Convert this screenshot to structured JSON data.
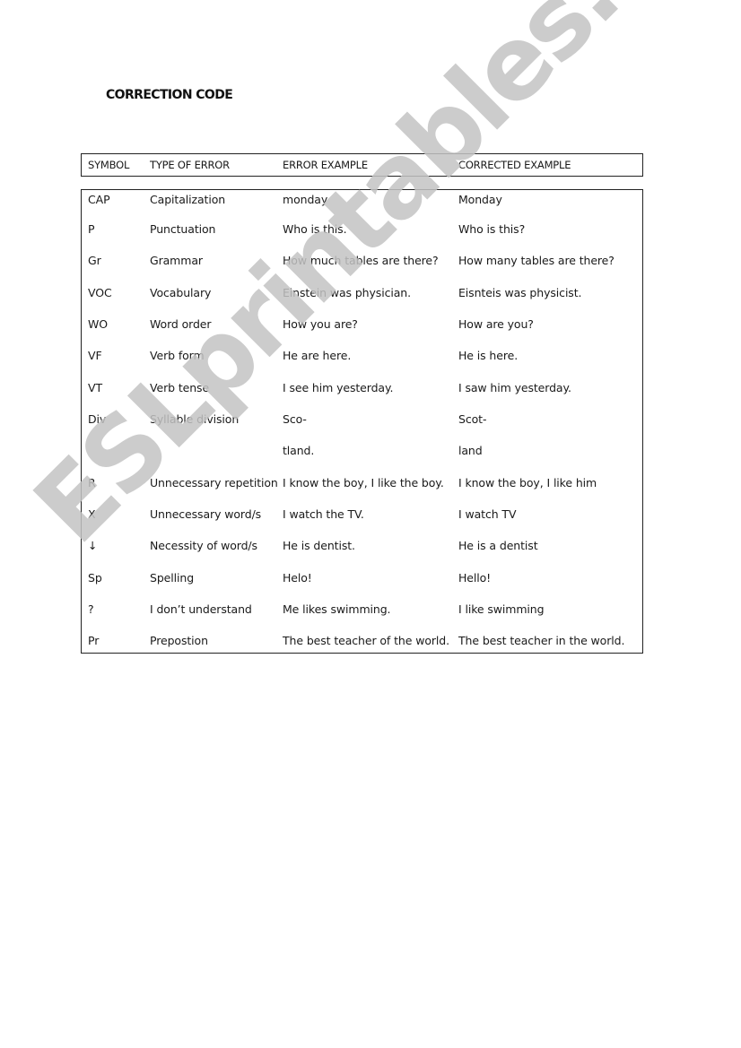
{
  "document": {
    "title": "CORRECTION CODE",
    "watermark": "ESLprintables.com"
  },
  "table": {
    "headers": {
      "symbol": "SYMBOL",
      "type": "TYPE OF ERROR",
      "error": "ERROR EXAMPLE",
      "corrected": "CORRECTED EXAMPLE"
    },
    "rows": [
      {
        "symbol": "CAP",
        "type": "Capitalization",
        "error": "monday",
        "corrected": "Monday"
      },
      {
        "symbol": "P",
        "type": "Punctuation",
        "error": "Who is this.",
        "corrected": "Who is this?"
      },
      {
        "symbol": "Gr",
        "type": "Grammar",
        "error": "How much tables are there?",
        "corrected": "How many tables are there?"
      },
      {
        "symbol": "VOC",
        "type": "Vocabulary",
        "error": "Einstein was physician.",
        "corrected": "Eisnteis was physicist."
      },
      {
        "symbol": "WO",
        "type": "Word order",
        "error": "How you are?",
        "corrected": "How are you?"
      },
      {
        "symbol": "VF",
        "type": "Verb form",
        "error": "He are here.",
        "corrected": "He is here."
      },
      {
        "symbol": "VT",
        "type": "Verb tense",
        "error": "I see him yesterday.",
        "corrected": "I saw him yesterday."
      },
      {
        "symbol": "Div",
        "type": "Syllable division",
        "error": "Sco-",
        "corrected": "Scot-"
      },
      {
        "symbol": "",
        "type": "",
        "error": "tland.",
        "corrected": "land"
      },
      {
        "symbol": "R",
        "type": "Unnecessary repetition",
        "error": "I know the boy, I like the boy.",
        "corrected": "I know the boy, I like him"
      },
      {
        "symbol": "X",
        "type": "Unnecessary word/s",
        "error": "I watch the TV.",
        "corrected": "I watch TV"
      },
      {
        "symbol": "↓",
        "type": "Necessity of word/s",
        "error": "He is dentist.",
        "corrected": "He is a dentist"
      },
      {
        "symbol": "Sp",
        "type": "Spelling",
        "error": "Helo!",
        "corrected": "Hello!"
      },
      {
        "symbol": "?",
        "type": "I don’t understand",
        "error": "Me likes swimming.",
        "corrected": "I like swimming"
      },
      {
        "symbol": "Pr",
        "type": "Prepostion",
        "error": "The best teacher of the world.",
        "corrected": "The best teacher in the world."
      }
    ]
  }
}
